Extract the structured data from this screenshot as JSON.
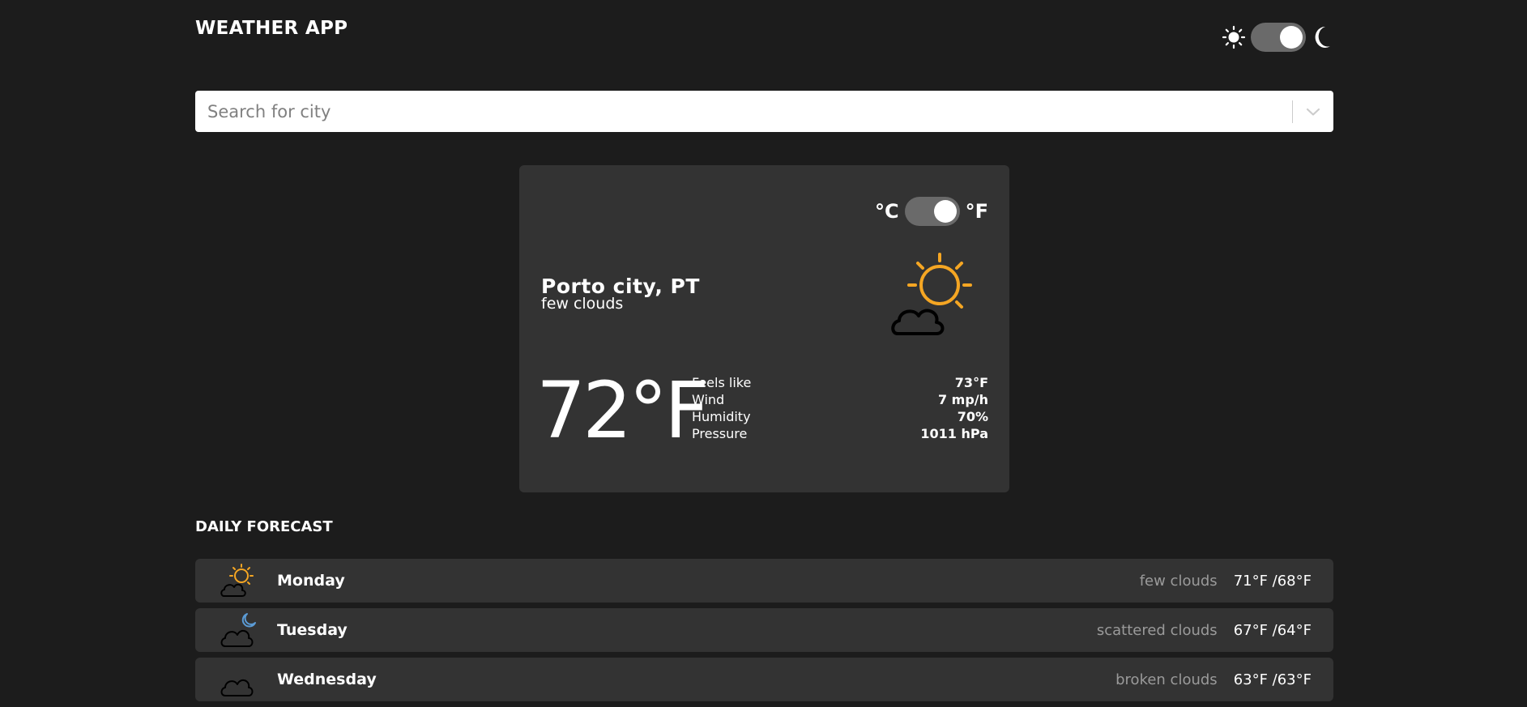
{
  "header": {
    "title": "WEATHER APP",
    "theme_icons": {
      "light": "sun-icon",
      "dark": "moon-icon"
    },
    "theme_toggle_state": "dark"
  },
  "search": {
    "placeholder": "Search for city",
    "dropdown_icon": "chevron-down-icon"
  },
  "current": {
    "units": {
      "celsius": "°C",
      "fahrenheit": "°F",
      "selected": "°F"
    },
    "city": "Porto city, PT",
    "description": "few clouds",
    "icon": "partly-cloudy-day-icon",
    "temperature": "72°F",
    "details": [
      {
        "label": "Feels like",
        "value": "73°F"
      },
      {
        "label": "Wind",
        "value": "7 mp/h"
      },
      {
        "label": "Humidity",
        "value": "70%"
      },
      {
        "label": "Pressure",
        "value": "1011 hPa"
      }
    ]
  },
  "forecast": {
    "title": "DAILY FORECAST",
    "days": [
      {
        "day": "Monday",
        "description": "few clouds",
        "range": "71°F /68°F",
        "icon": "partly-cloudy-day-icon"
      },
      {
        "day": "Tuesday",
        "description": "scattered clouds",
        "range": "67°F /64°F",
        "icon": "cloudy-night-icon"
      },
      {
        "day": "Wednesday",
        "description": "broken clouds",
        "range": "63°F /63°F",
        "icon": "cloud-icon"
      }
    ]
  },
  "colors": {
    "background": "#1c1c1c",
    "card": "#333333",
    "accent_sun": "#f5a623",
    "moon_accent": "#5b9bd5",
    "muted_text": "#9a9a9a"
  }
}
